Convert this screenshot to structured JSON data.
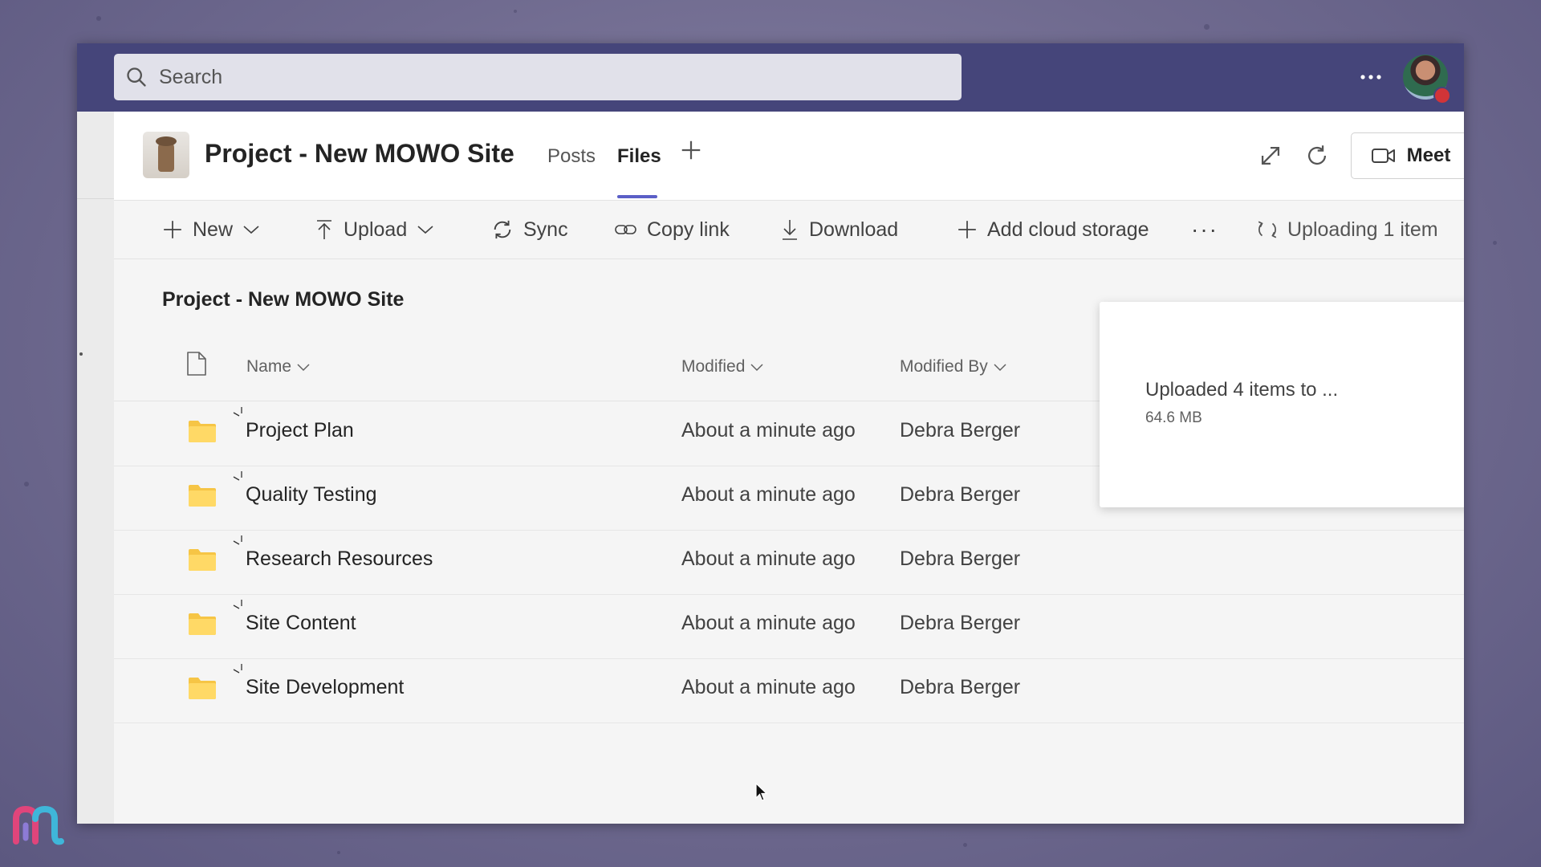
{
  "search": {
    "placeholder": "Search"
  },
  "header": {
    "team_name": "Project - New MOWO Site",
    "tabs": [
      {
        "label": "Posts",
        "active": false
      },
      {
        "label": "Files",
        "active": true
      }
    ],
    "meet_label": "Meet"
  },
  "toolbar": {
    "new_label": "New",
    "upload_label": "Upload",
    "sync_label": "Sync",
    "copy_link_label": "Copy link",
    "download_label": "Download",
    "add_cloud_label": "Add cloud storage",
    "more_label": "···",
    "uploading_label": "Uploading 1 item"
  },
  "content": {
    "breadcrumb": "Project - New MOWO Site",
    "columns": {
      "name": "Name",
      "modified": "Modified",
      "modified_by": "Modified By"
    },
    "rows": [
      {
        "name": "Project Plan",
        "modified": "About a minute ago",
        "modified_by": "Debra Berger"
      },
      {
        "name": "Quality Testing",
        "modified": "About a minute ago",
        "modified_by": "Debra Berger"
      },
      {
        "name": "Research Resources",
        "modified": "About a minute ago",
        "modified_by": "Debra Berger"
      },
      {
        "name": "Site Content",
        "modified": "About a minute ago",
        "modified_by": "Debra Berger"
      },
      {
        "name": "Site Development",
        "modified": "About a minute ago",
        "modified_by": "Debra Berger"
      }
    ]
  },
  "upload_status": {
    "title": "Uploaded 4 items to ...",
    "size": "64.6 MB"
  },
  "colors": {
    "topbar": "#45457a",
    "accent": "#5b5fc7",
    "folder": "#f6c545",
    "presence_busy": "#d13438"
  },
  "icons": [
    "search-icon",
    "more-icon",
    "expand-icon",
    "refresh-icon",
    "video-camera-icon",
    "chevron-down-icon",
    "plus-icon",
    "upload-icon",
    "sync-icon",
    "link-icon",
    "download-icon",
    "file-icon",
    "folder-icon",
    "uploading-sync-icon"
  ]
}
